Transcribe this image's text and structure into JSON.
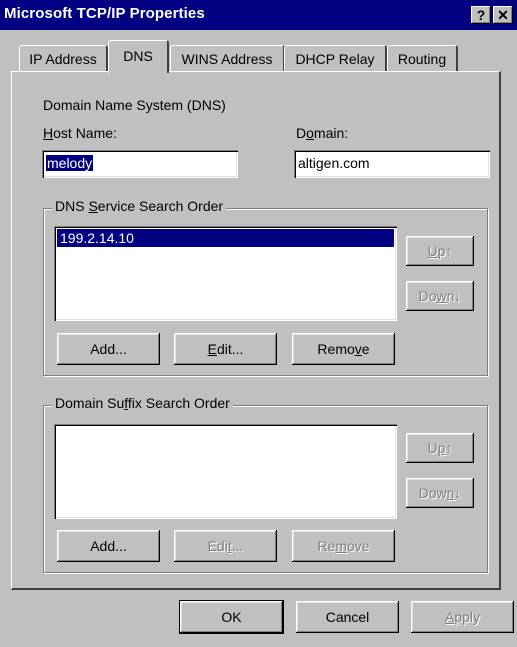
{
  "window": {
    "title": "Microsoft TCP/IP Properties",
    "help_glyph": "?",
    "close_glyph": "✕"
  },
  "tabs": [
    {
      "label": "IP Address"
    },
    {
      "label": "DNS"
    },
    {
      "label": "WINS Address"
    },
    {
      "label": "DHCP Relay"
    },
    {
      "label": "Routing"
    }
  ],
  "dns": {
    "section_title": "Domain Name System (DNS)",
    "host_label": "Host Name:",
    "host_value": "melody",
    "domain_label": "Domain:",
    "domain_value": "altigen.com",
    "service_group": {
      "label": "DNS Service Search Order",
      "items": [
        "199.2.14.10"
      ],
      "up_label": "Up↑",
      "down_label": "Down↓",
      "add_label": "Add...",
      "edit_label": "Edit...",
      "remove_label": "Remove"
    },
    "suffix_group": {
      "label": "Domain Suffix Search Order",
      "items": [],
      "up_label": "Up↑",
      "down_label": "Down↓",
      "add_label": "Add...",
      "edit_label": "Edit...",
      "remove_label": "Remove"
    }
  },
  "footer": {
    "ok_label": "OK",
    "cancel_label": "Cancel",
    "apply_label": "Apply"
  }
}
